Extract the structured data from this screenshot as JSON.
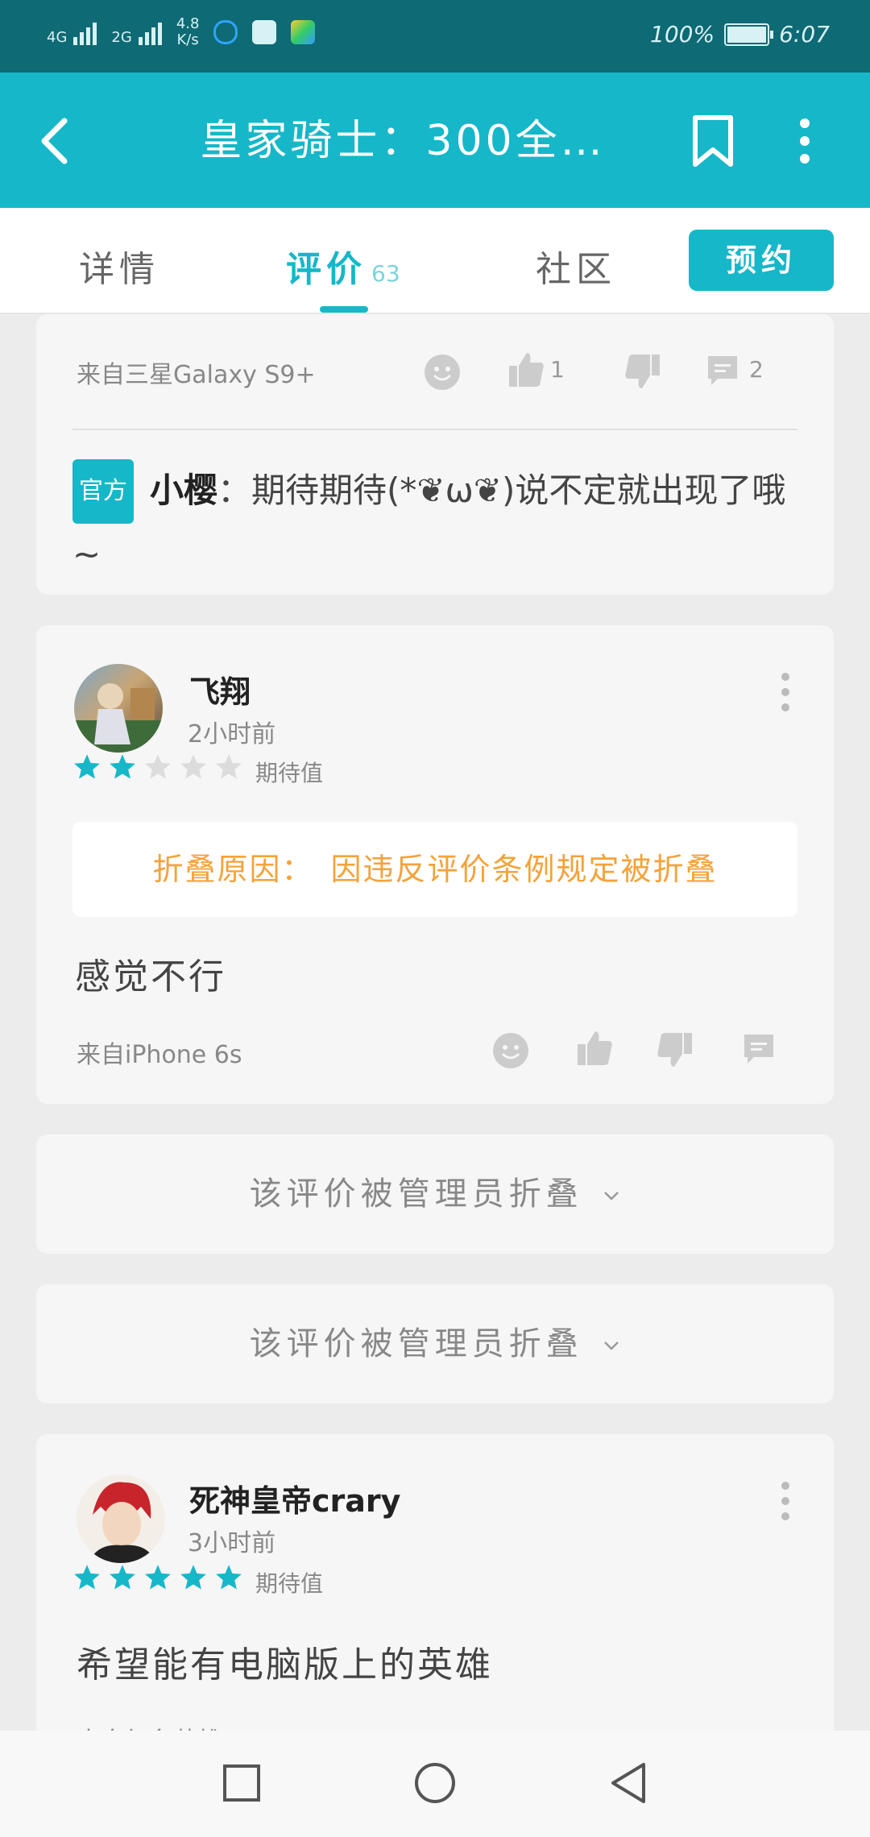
{
  "status_bar": {
    "sim1": "4G",
    "sim2": "2G",
    "speed_value": "4.8",
    "speed_unit": "K/s",
    "battery": "100%",
    "time": "6:07"
  },
  "app_bar": {
    "title": "皇家骑士：300全…"
  },
  "tabs": {
    "details": "详情",
    "reviews": "评价",
    "reviews_count": "63",
    "community": "社区",
    "reserve": "预约"
  },
  "review_top": {
    "source": "来自三星Galaxy S9+",
    "likes": "1",
    "comments": "2",
    "official_badge": "官方",
    "reply_author": "小樱",
    "reply_sep": "：",
    "reply_text": "期待期待(*❦ω❦)说不定就出现了哦~"
  },
  "review_1": {
    "username": "飞翔",
    "time": "2小时前",
    "rating": 2,
    "rating_label": "期待值",
    "fold_notice": "折叠原因：　因违反评价条例规定被折叠",
    "body": "感觉不行",
    "source": "来自iPhone 6s"
  },
  "collapsed_1": {
    "text": "该评价被管理员折叠"
  },
  "collapsed_2": {
    "text": "该评价被管理员折叠"
  },
  "review_2": {
    "username": "死神皇帝crary",
    "time": "3小时前",
    "rating": 5,
    "rating_label": "期待值",
    "body": "希望能有电脑版上的英雄",
    "source": "来自红名英雄…"
  },
  "colors": {
    "accent": "#16b7c8",
    "status_bar": "#0e6a74",
    "fold_notice": "#f5a23a",
    "star_empty": "#dcdcdc"
  }
}
